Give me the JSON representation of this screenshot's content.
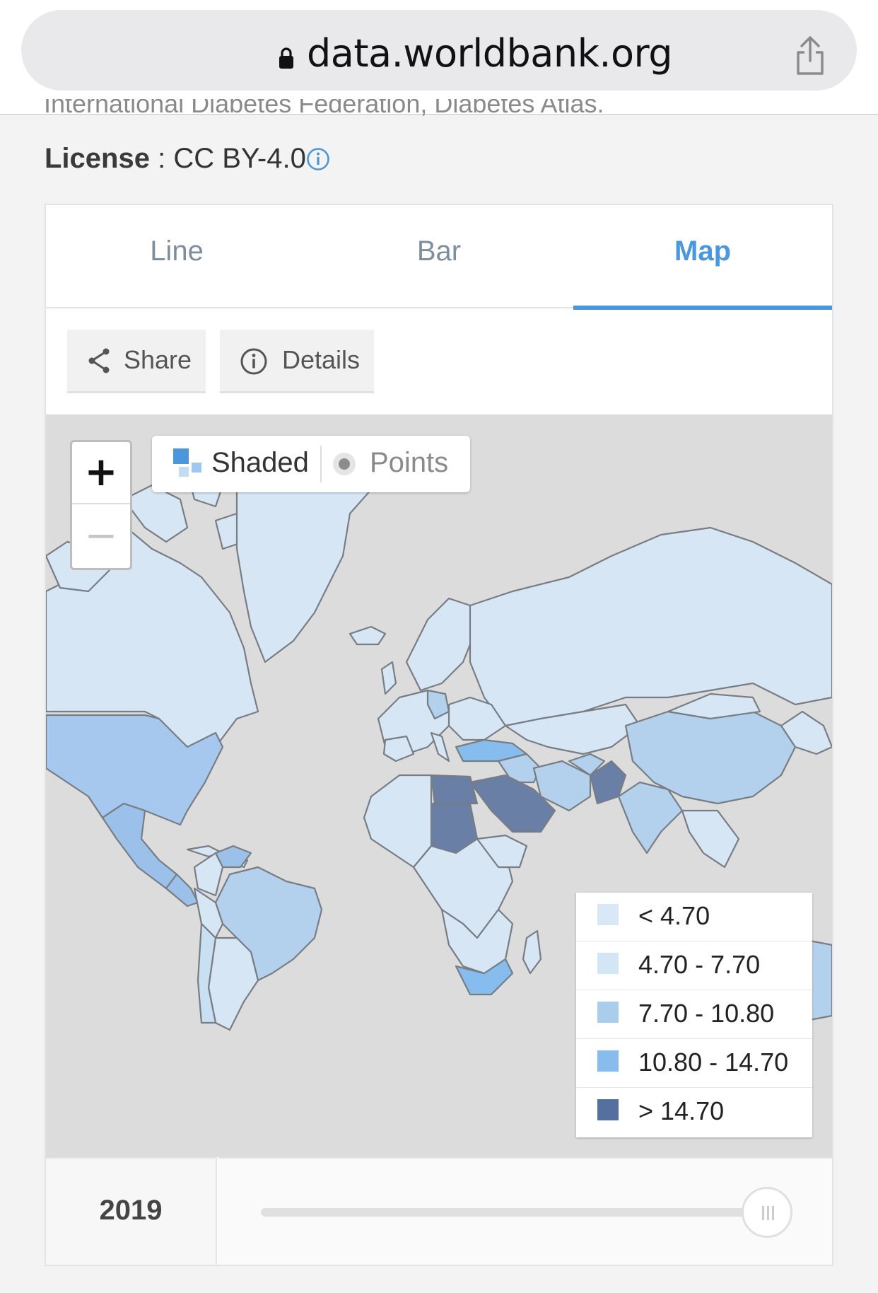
{
  "browser": {
    "url": "data.worldbank.org",
    "lock_icon": "lock-icon",
    "share_icon": "share-up-icon"
  },
  "source_line": "International Diabetes Federation, Diabetes Atlas.",
  "license": {
    "label": "License",
    "separator": " : ",
    "value": "CC BY-4.0"
  },
  "tabs": [
    {
      "label": "Line",
      "active": false
    },
    {
      "label": "Bar",
      "active": false
    },
    {
      "label": "Map",
      "active": true
    }
  ],
  "actions": {
    "share_label": "Share",
    "details_label": "Details"
  },
  "map": {
    "zoom_in": "+",
    "zoom_out": "−",
    "mode_shaded": "Shaded",
    "mode_points": "Points",
    "selected_mode": "Shaded",
    "legend": [
      {
        "label": "< 4.70",
        "color": "#d8e8f6"
      },
      {
        "label": "4.70 - 7.70",
        "color": "#d2e6f6"
      },
      {
        "label": "7.70 - 10.80",
        "color": "#a9cdea"
      },
      {
        "label": "10.80 - 14.70",
        "color": "#86bcee"
      },
      {
        "label": "> 14.70",
        "color": "#55709e"
      }
    ]
  },
  "slider": {
    "year": "2019",
    "position": 1.0
  },
  "colors": {
    "accent": "#4a97dc",
    "map_background": "#dcdcdc"
  }
}
